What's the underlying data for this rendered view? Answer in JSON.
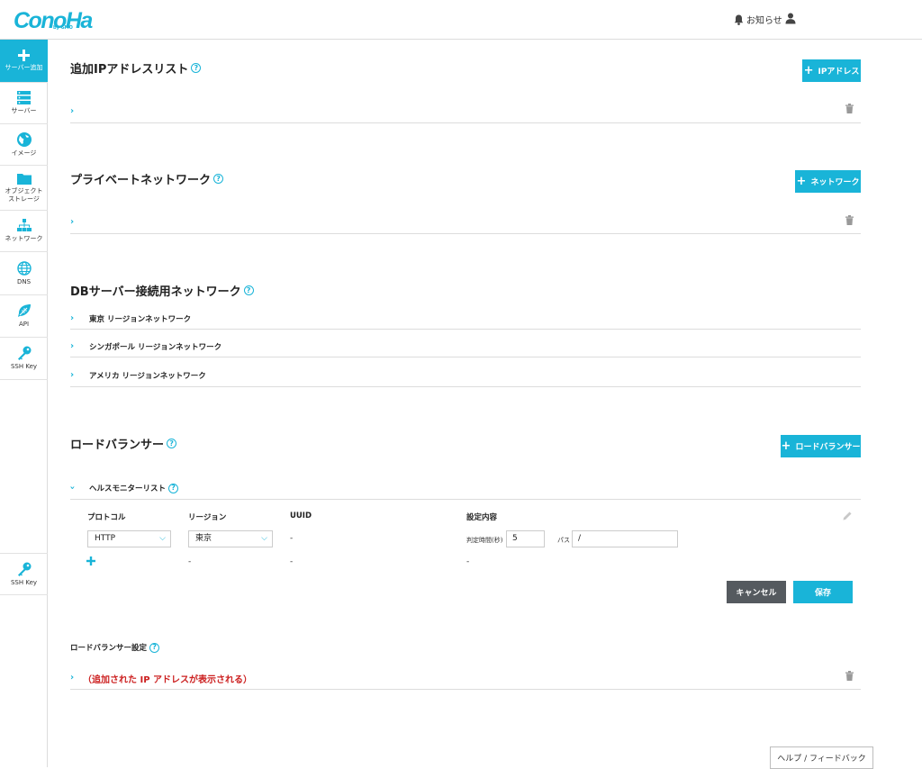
{
  "header": {
    "logo": "ConoHa",
    "logo_sub": "by GMO",
    "notifications_label": "お知らせ"
  },
  "sidebar": {
    "items": [
      {
        "label": "サーバー追加",
        "icon": "plus-icon",
        "active": true
      },
      {
        "label": "サーバー",
        "icon": "server-icon"
      },
      {
        "label": "イメージ",
        "icon": "globe-icon"
      },
      {
        "label": "オブジェクト\nストレージ",
        "label1": "オブジェクト",
        "label2": "ストレージ",
        "icon": "folder-icon"
      },
      {
        "label": "ネットワーク",
        "icon": "network-icon"
      },
      {
        "label": "DNS",
        "icon": "dns-globe-icon"
      },
      {
        "label": "API",
        "icon": "api-leaf-icon"
      },
      {
        "label": "SSH Key",
        "icon": "key-icon"
      }
    ],
    "bottom_item": {
      "label": "SSH Key",
      "icon": "key-icon"
    }
  },
  "sections": {
    "additional_ip": {
      "title": "追加IPアドレスリスト",
      "add_button": "IPアドレス"
    },
    "private_network": {
      "title": "プライベートネットワーク",
      "add_button": "ネットワーク"
    },
    "db_network": {
      "title": "DBサーバー接続用ネットワーク",
      "rows": [
        "東京 リージョンネットワーク",
        "シンガポール リージョンネットワーク",
        "アメリカ リージョンネットワーク"
      ]
    },
    "load_balancer": {
      "title": "ロードバランサー",
      "add_button": "ロードバランサー",
      "health_monitor": {
        "title": "ヘルスモニターリスト",
        "columns": [
          "プロトコル",
          "リージョン",
          "UUID",
          "設定内容"
        ],
        "protocol_value": "HTTP",
        "region_value": "東京",
        "uuid_value": "-",
        "interval_label": "判定時間(秒)",
        "interval_value": "5",
        "path_label": "パス",
        "path_value": "/",
        "new_row_region": "-",
        "new_row_uuid": "-",
        "new_row_settings": "-",
        "cancel_label": "キャンセル",
        "save_label": "保存"
      }
    },
    "lb_settings": {
      "title": "ロードバランサー設定",
      "row_text": "（追加された IP アドレスが表示される）"
    }
  },
  "feedback_label": "ヘルプ / フィードバック",
  "colors": {
    "accent": "#19b4d8",
    "dark_button": "#555a5f",
    "note_red": "#cc2020"
  }
}
